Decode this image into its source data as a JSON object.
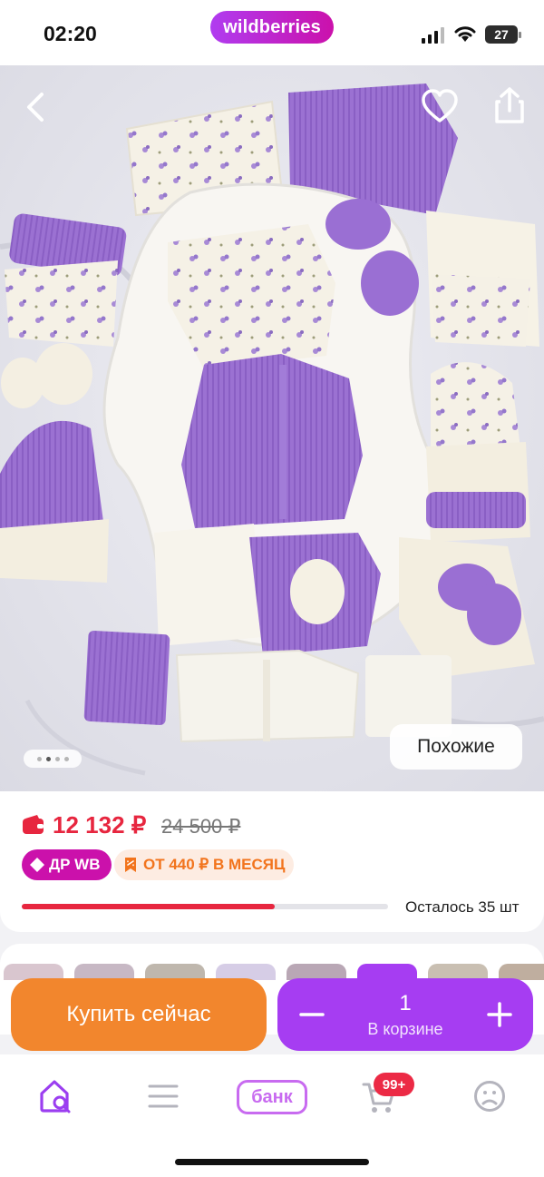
{
  "status_bar": {
    "time": "02:20",
    "brand_pill": "wildberries",
    "battery": "27"
  },
  "product_image": {
    "alt": "Product photo",
    "carousel_dots": 4,
    "active_dot": 1,
    "similar_label": "Похожие"
  },
  "pricing": {
    "price": "12 132 ₽",
    "old_price": "24 500 ₽",
    "badge_dr": "ДР WB",
    "badge_installment": "ОТ 440 ₽ В МЕСЯЦ",
    "stock_progress": 0.69,
    "stock_text": "Осталось 35 шт"
  },
  "actions": {
    "buy_now": "Купить сейчас",
    "quantity": "1",
    "in_cart": "В корзине"
  },
  "tabbar": {
    "bank_label": "банк",
    "cart_badge": "99+"
  },
  "colors": {
    "accent_purple": "#a63df2",
    "brand_magenta": "#cb11ab",
    "price_red": "#e7263f",
    "buy_orange": "#f2862d"
  }
}
